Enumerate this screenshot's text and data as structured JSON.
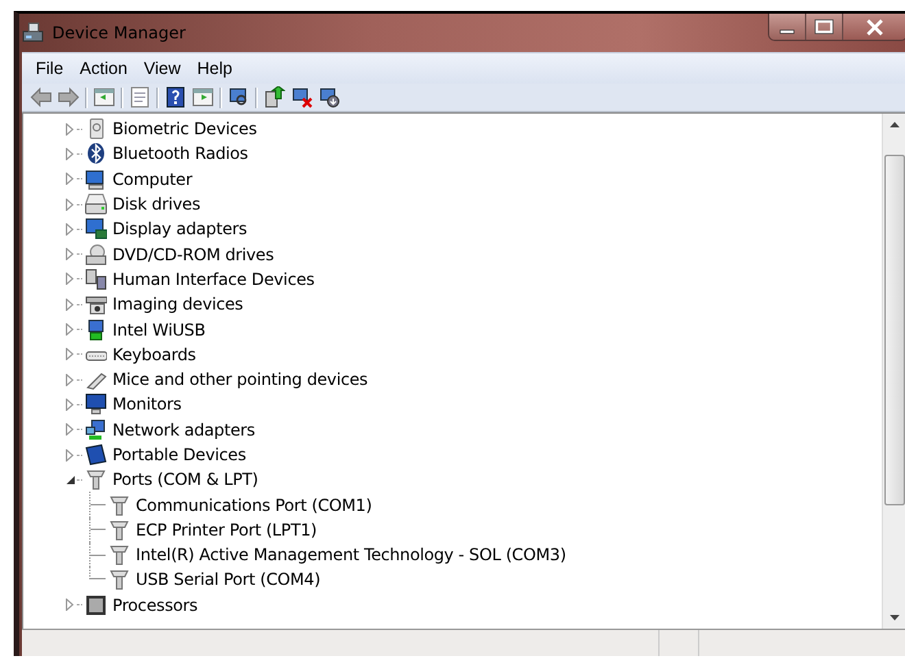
{
  "window": {
    "title": "Device Manager"
  },
  "menu": [
    "File",
    "Action",
    "View",
    "Help"
  ],
  "tree": [
    {
      "label": "Biometric Devices",
      "expanded": false
    },
    {
      "label": "Bluetooth Radios",
      "expanded": false
    },
    {
      "label": "Computer",
      "expanded": false
    },
    {
      "label": "Disk drives",
      "expanded": false
    },
    {
      "label": "Display adapters",
      "expanded": false
    },
    {
      "label": "DVD/CD-ROM drives",
      "expanded": false
    },
    {
      "label": "Human Interface Devices",
      "expanded": false
    },
    {
      "label": "Imaging devices",
      "expanded": false
    },
    {
      "label": "Intel WiUSB",
      "expanded": false
    },
    {
      "label": "Keyboards",
      "expanded": false
    },
    {
      "label": "Mice and other pointing devices",
      "expanded": false
    },
    {
      "label": "Monitors",
      "expanded": false
    },
    {
      "label": "Network adapters",
      "expanded": false
    },
    {
      "label": "Portable Devices",
      "expanded": false
    },
    {
      "label": "Ports (COM & LPT)",
      "expanded": true,
      "children": [
        {
          "label": "Communications Port (COM1)"
        },
        {
          "label": "ECP Printer Port (LPT1)"
        },
        {
          "label": "Intel(R) Active Management Technology - SOL (COM3)"
        },
        {
          "label": "USB Serial Port (COM4)"
        }
      ]
    },
    {
      "label": "Processors",
      "expanded": false
    }
  ]
}
